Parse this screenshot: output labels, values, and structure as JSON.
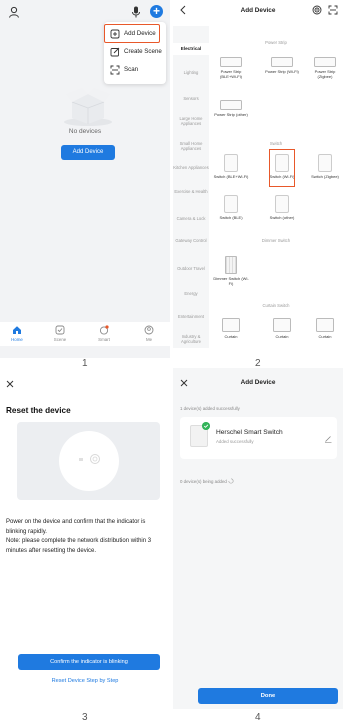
{
  "screen1": {
    "menu": {
      "items": [
        {
          "label": "Add Device",
          "icon": "add-device-icon"
        },
        {
          "label": "Create Scene",
          "icon": "edit-icon"
        },
        {
          "label": "Scan",
          "icon": "scan-icon"
        }
      ]
    },
    "empty_text": "No devices",
    "add_button": "Add Device",
    "tabs": [
      {
        "label": "Home",
        "icon": "home-icon",
        "active": true
      },
      {
        "label": "Scene",
        "icon": "scene-icon",
        "active": false
      },
      {
        "label": "Smart",
        "icon": "smart-icon",
        "active": false
      },
      {
        "label": "Me",
        "icon": "me-icon",
        "active": false
      }
    ],
    "number": "1"
  },
  "screen2": {
    "title": "Add Device",
    "categories": [
      "Electrical",
      "Lighting",
      "Sensors",
      "Large Home Appliances",
      "Small Home Appliances",
      "Kitchen Appliances",
      "Exercise & Health",
      "Camera & Lock",
      "Gateway Control",
      "Outdoor Travel",
      "Energy",
      "Entertainment",
      "Industry & Agriculture"
    ],
    "sections": {
      "power_strip": "Power Strip",
      "switch": "Switch",
      "dimmer": "Dimmer Switch",
      "curtain": "Curtain Switch"
    },
    "devices": {
      "power_strip": [
        "Power Strip (BLE+Wi-Fi)",
        "Power Strip (Wi-Fi)",
        "Power Strip (Zigbee)",
        "Power Strip (other)"
      ],
      "switch": [
        "Switch (BLE+Wi-Fi)",
        "Switch (Wi-Fi)",
        "Switch (Zigbee)",
        "Switch (BLE)",
        "Switch (other)"
      ],
      "dimmer": [
        "Dimmer Switch (Wi-Fi)"
      ],
      "curtain": [
        "Curtain",
        "Curtain",
        "Curtain"
      ]
    },
    "highlight_color": "#e8582a",
    "number": "2"
  },
  "screen3": {
    "title": "Reset the device",
    "instructions": [
      "Power on the device and confirm that the indicator is blinking rapidly.",
      "Note: please complete the network distribution within 3 minutes after resetting the device."
    ],
    "confirm_button": "Confirm the indicator is blinking",
    "step_link": "Reset Device Step by Step",
    "number": "3"
  },
  "screen4": {
    "title": "Add Device",
    "added_summary": "1 device(s) added successfully",
    "device_name": "Herschel Smart Switch",
    "device_status": "Added successfully",
    "adding_summary": "0 device(s) being added",
    "done_button": "Done",
    "number": "4"
  },
  "colors": {
    "accent": "#1f7ae0",
    "highlight": "#e8582a",
    "success": "#33b35a"
  }
}
